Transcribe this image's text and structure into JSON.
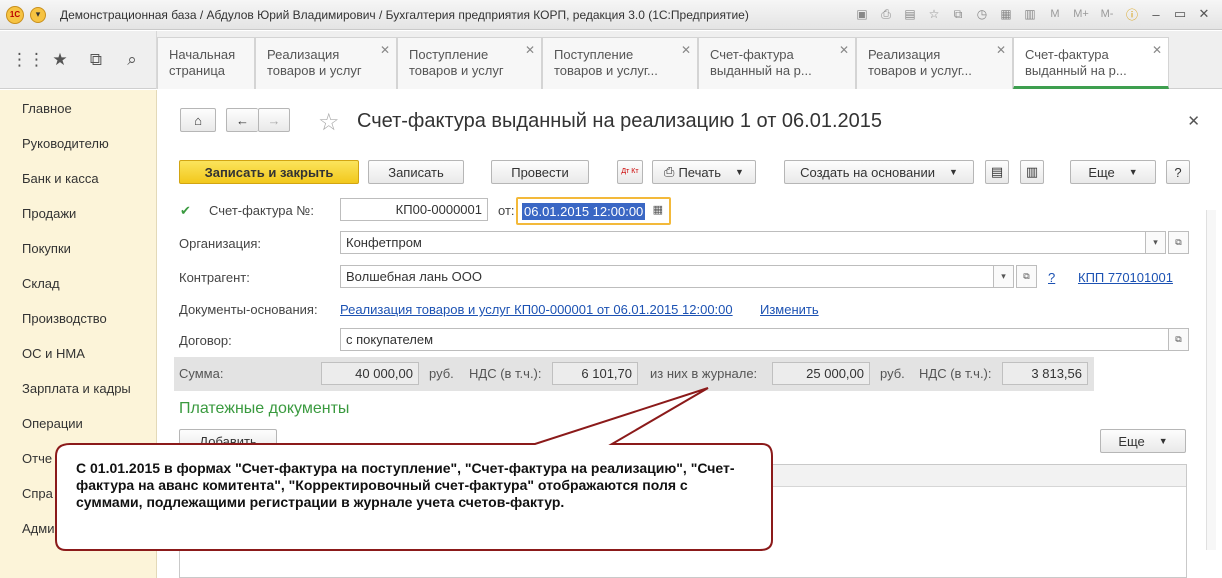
{
  "window": {
    "title": "Демонстрационная база / Абдулов Юрий Владимирович / Бухгалтерия предприятия КОРП, редакция 3.0  (1С:Предприятие)",
    "logo_text": "1С",
    "tool_m": "M",
    "tool_mplus": "M+",
    "tool_mminus": "M-"
  },
  "tabs": [
    {
      "line1": "Начальная",
      "line2": "страница"
    },
    {
      "line1": "Реализация",
      "line2": "товаров и услуг"
    },
    {
      "line1": "Поступление",
      "line2": "товаров и услуг"
    },
    {
      "line1": "Поступление",
      "line2": "товаров и услуг..."
    },
    {
      "line1": "Счет-фактура",
      "line2": "выданный на р..."
    },
    {
      "line1": "Реализация",
      "line2": "товаров и услуг..."
    },
    {
      "line1": "Счет-фактура",
      "line2": "выданный на р..."
    }
  ],
  "sidebar": {
    "items": [
      "Главное",
      "Руководителю",
      "Банк и касса",
      "Продажи",
      "Покупки",
      "Склад",
      "Производство",
      "ОС и НМА",
      "Зарплата и кадры",
      "Операции",
      "Отчеты",
      "Справочники",
      "Администрирование"
    ],
    "visible": [
      "Главное",
      "Руководителю",
      "Банк и касса",
      "Продажи",
      "Покупки",
      "Склад",
      "Производство",
      "ОС и НМА",
      "Зарплата и кадры",
      "Операции",
      "Отче",
      "Спра",
      "Адми"
    ]
  },
  "form": {
    "title": "Счет-фактура выданный на реализацию 1 от 06.01.2015",
    "buttons": {
      "save_close": "Записать и закрыть",
      "save": "Записать",
      "post": "Провести",
      "print": "Печать",
      "create_based": "Создать на основании",
      "more": "Еще",
      "help": "?",
      "dtkt": "Дт Кт"
    },
    "number_label": "Счет-фактура №:",
    "number_value": "КП00-0000001",
    "from_label": "от:",
    "date_value": "06.01.2015 12:00:00",
    "org_label": "Организация:",
    "org_value": "Конфетпром",
    "counterparty_label": "Контрагент:",
    "counterparty_value": "Волшебная лань ООО",
    "question": "?",
    "kpp": "КПП 770101001",
    "docs_label": "Документы-основания:",
    "docs_link": "Реализация товаров и услуг КП00-000001 от 06.01.2015 12:00:00",
    "change_link": "Изменить",
    "contract_label": "Договор:",
    "contract_value": "с покупателем",
    "sum_label": "Сумма:",
    "sum_value": "40 000,00",
    "rub1": "руб.",
    "vat_label1": "НДС (в т.ч.):",
    "vat_value1": "6 101,70",
    "journal_label": "из них в журнале:",
    "journal_value": "25 000,00",
    "rub2": "руб.",
    "vat_label2": "НДС (в т.ч.):",
    "vat_value2": "3 813,56",
    "payments_title": "Платежные документы",
    "add_button": "Добавить",
    "more2": "Еще"
  },
  "callout": {
    "text": "С 01.01.2015 в формах \"Счет-фактура на поступление\", \"Счет-фактура на реализацию\", \"Счет-фактура на аванс комитента\", \"Корректировочный счет-фактура\" отображаются поля с суммами, подлежащими регистрации в журнале учета счетов-фактур."
  },
  "colors": {
    "accent_yellow": "#f2c81c",
    "accent_green": "#3e9f4f",
    "callout_border": "#8b1a1a",
    "link_blue": "#1c52b3"
  }
}
